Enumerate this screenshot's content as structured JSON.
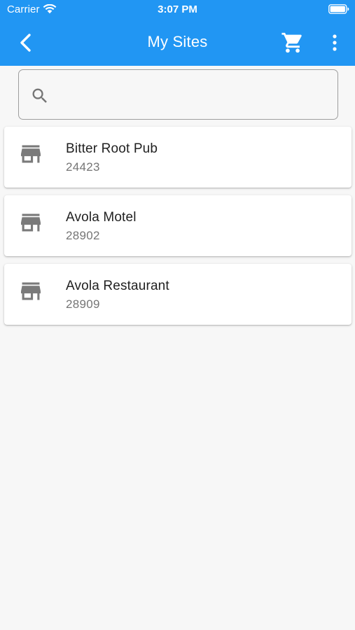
{
  "status_bar": {
    "carrier": "Carrier",
    "time": "3:07 PM"
  },
  "app_bar": {
    "title": "My Sites",
    "back_icon": "chevron-left-icon",
    "cart_icon": "shopping-cart-icon",
    "more_icon": "more-vert-icon"
  },
  "search": {
    "value": "",
    "placeholder": "",
    "icon": "search-icon"
  },
  "sites": [
    {
      "name": "Bitter Root Pub",
      "code": "24423",
      "icon": "store-icon"
    },
    {
      "name": "Avola Motel",
      "code": "28902",
      "icon": "store-icon"
    },
    {
      "name": "Avola Restaurant",
      "code": "28909",
      "icon": "store-icon"
    }
  ],
  "colors": {
    "primary": "#2196f3",
    "background": "#f7f7f7",
    "card": "#ffffff",
    "title_text": "#212121",
    "subtitle_text": "#757575",
    "icon_gray": "#7a7a7a"
  }
}
